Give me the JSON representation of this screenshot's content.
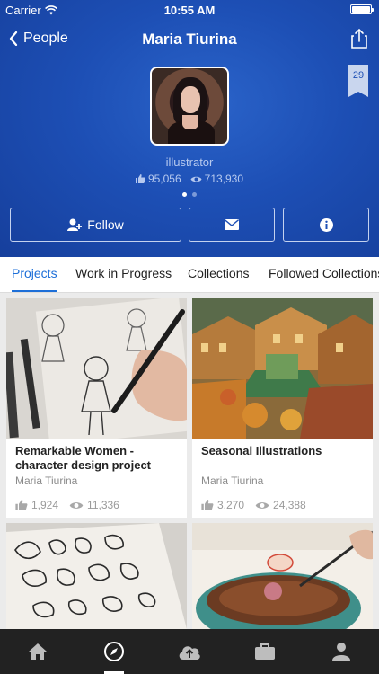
{
  "status_bar": {
    "carrier": "Carrier",
    "time": "10:55 AM"
  },
  "nav": {
    "back_label": "People",
    "title": "Maria Tiurina"
  },
  "profile": {
    "occupation": "illustrator",
    "appreciations": "95,056",
    "views": "713,930",
    "badge_count": "29",
    "page_dots": 2,
    "active_dot": 0
  },
  "actions": {
    "follow_label": "Follow"
  },
  "tabs": [
    {
      "label": "Projects",
      "active": true
    },
    {
      "label": "Work in Progress",
      "active": false
    },
    {
      "label": "Collections",
      "active": false
    },
    {
      "label": "Followed Collections",
      "active": false
    }
  ],
  "projects": [
    {
      "title": "Remarkable Women - character design project",
      "author": "Maria Tiurina",
      "likes": "1,924",
      "views": "11,336"
    },
    {
      "title": "Seasonal Illustrations",
      "author": "Maria Tiurina",
      "likes": "3,270",
      "views": "24,388"
    },
    {
      "title": "",
      "author": "",
      "likes": "",
      "views": ""
    },
    {
      "title": "",
      "author": "",
      "likes": "",
      "views": ""
    }
  ],
  "tab_bar": [
    {
      "icon": "home-icon",
      "active": false
    },
    {
      "icon": "compass-icon",
      "active": true
    },
    {
      "icon": "cloud-upload-icon",
      "active": false
    },
    {
      "icon": "briefcase-icon",
      "active": false
    },
    {
      "icon": "user-icon",
      "active": false
    }
  ],
  "colors": {
    "header_blue": "#1d4fb5",
    "accent_blue": "#1d6fd8",
    "tab_bar": "#222222"
  }
}
